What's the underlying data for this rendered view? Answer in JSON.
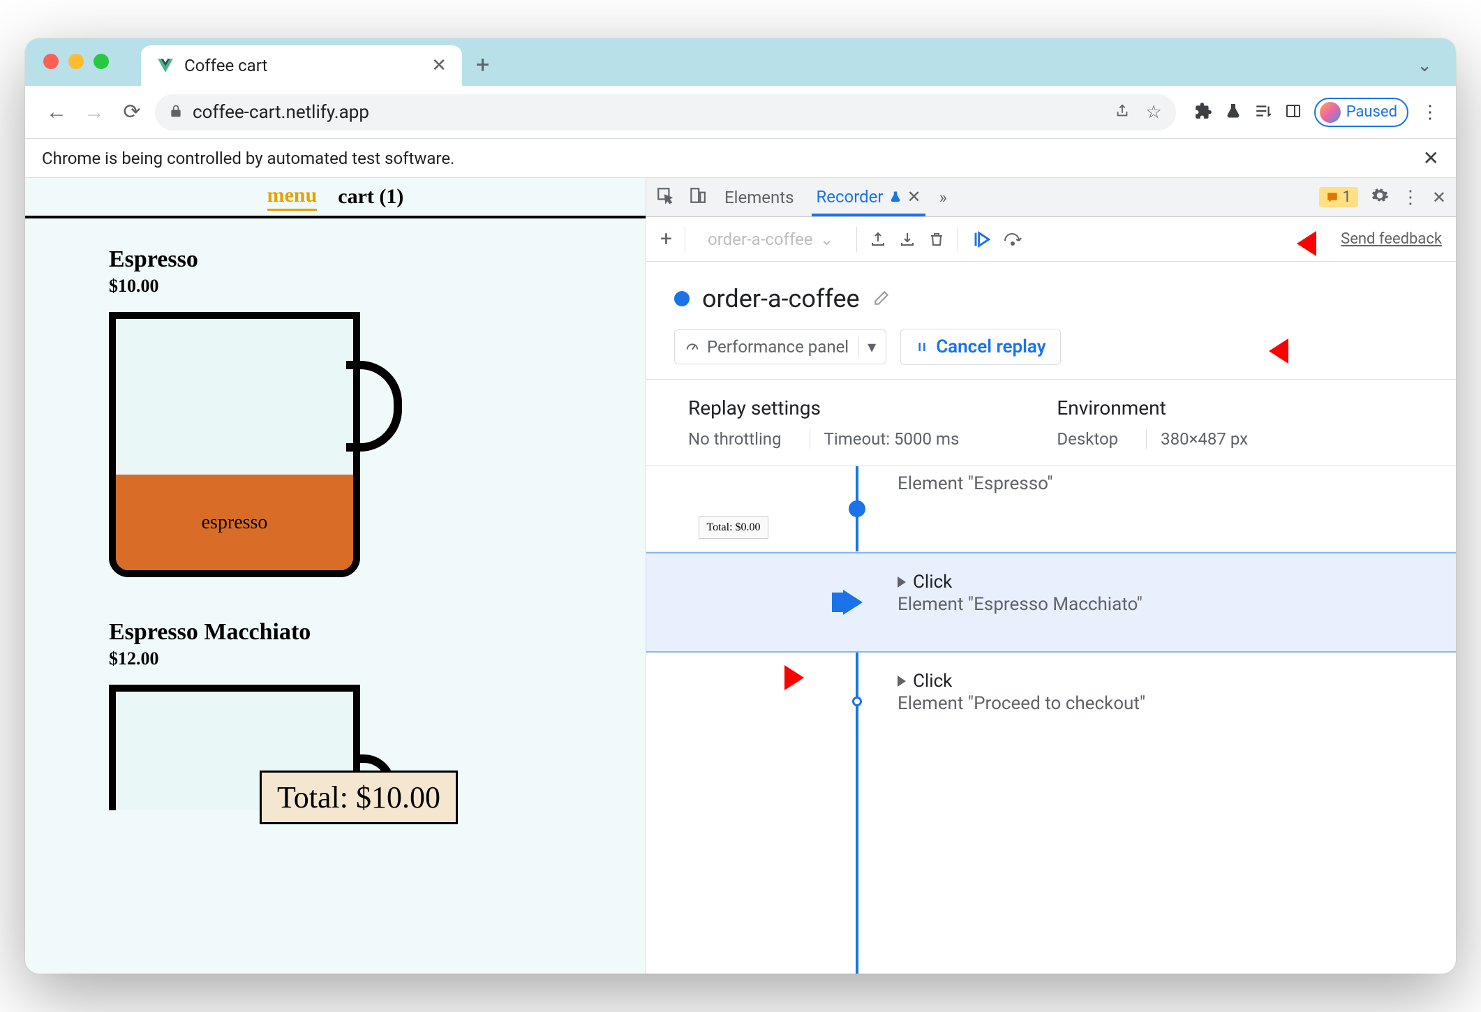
{
  "browser": {
    "tab_title": "Coffee cart",
    "url": "coffee-cart.netlify.app",
    "profile_status": "Paused",
    "automation_message": "Chrome is being controlled by automated test software."
  },
  "page": {
    "nav_menu": "menu",
    "nav_cart": "cart (1)",
    "products": [
      {
        "name": "Espresso",
        "price": "$10.00",
        "fill_label": "espresso"
      },
      {
        "name": "Espresso Macchiato",
        "price": "$12.00"
      }
    ],
    "total_label": "Total: $10.00"
  },
  "devtools": {
    "tabs": {
      "elements": "Elements",
      "recorder": "Recorder"
    },
    "issues_count": "1",
    "toolbar": {
      "recording_selector": "order-a-coffee",
      "send_feedback": "Send feedback"
    },
    "recording_name": "order-a-coffee",
    "performance_panel": "Performance panel",
    "cancel_replay": "Cancel replay",
    "settings": {
      "replay_label": "Replay settings",
      "throttling": "No throttling",
      "timeout": "Timeout: 5000 ms",
      "env_label": "Environment",
      "device": "Desktop",
      "viewport": "380×487 px"
    },
    "steps": [
      {
        "thumb_total": "Total: $0.00",
        "target": "Element \"Espresso\""
      },
      {
        "action": "Click",
        "target": "Element \"Espresso Macchiato\""
      },
      {
        "action": "Click",
        "target": "Element \"Proceed to checkout\""
      }
    ]
  }
}
